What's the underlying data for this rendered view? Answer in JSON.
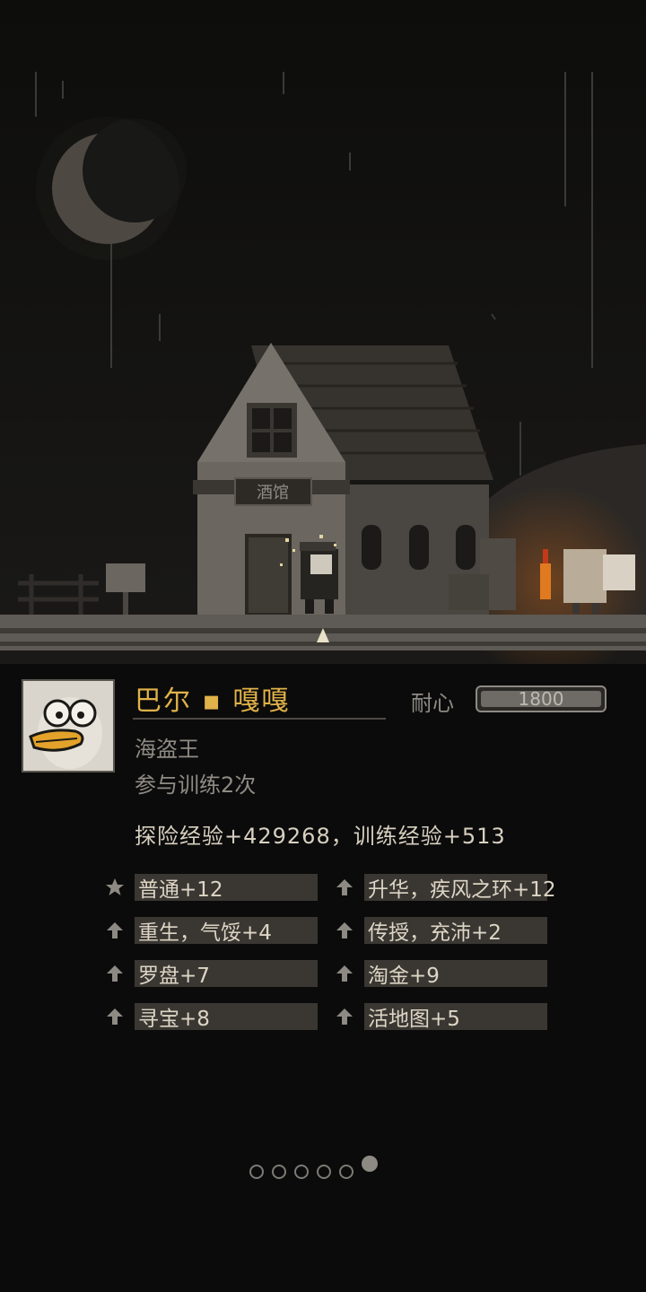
{
  "scene": {
    "tavern_sign": "酒馆"
  },
  "character": {
    "name": "巴尔 ▪ 嘎嘎",
    "title": "海盗王",
    "training_count": "参与训练2次",
    "portrait": "duck-portrait-icon"
  },
  "patience": {
    "label": "耐心",
    "value": "1800",
    "fill_fraction": 1.0
  },
  "experience": "探险经验+429268，训练经验+513",
  "skills": [
    {
      "icon": "star-icon",
      "label": "普通+12"
    },
    {
      "icon": "up-arrow-icon",
      "label": "升华，疾风之环+12"
    },
    {
      "icon": "up-arrow-icon",
      "label": "重生，气馁+4"
    },
    {
      "icon": "up-arrow-icon",
      "label": "传授，充沛+2"
    },
    {
      "icon": "up-arrow-icon",
      "label": "罗盘+7"
    },
    {
      "icon": "up-arrow-icon",
      "label": "淘金+9"
    },
    {
      "icon": "up-arrow-icon",
      "label": "寻宝+8"
    },
    {
      "icon": "up-arrow-icon",
      "label": "活地图+5"
    }
  ],
  "pagination": {
    "total": 6,
    "active": 6
  },
  "colors": {
    "name": "#e0b24a",
    "muted_text": "#8f8b84",
    "skill_box": "#3a3733",
    "background": "#0b0b0b",
    "torch": "#e07a20"
  }
}
